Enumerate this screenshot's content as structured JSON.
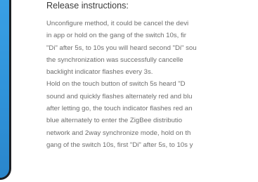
{
  "section": {
    "title": "Release instructions:",
    "lines": [
      "Unconfigure method, it could be cancel the devi",
      "in app or hold on the gang of the switch 10s, fir",
      "\"Di\" after 5s, to 10s you will heard second \"Di\" sou",
      "the synchronization was successfully cancelle",
      "backlight indicator flashes every 3s.",
      "Hold on the touch button of switch 5s heard \"D",
      "sound and quickly flashes alternately red and blu",
      "after letting go, the touch indicator flashes red an",
      "blue alternately to enter the ZigBee distributio",
      "network and 2way synchronize mode, hold on th",
      "gang of the switch 10s, first \"Di\" after 5s, to 10s y"
    ]
  },
  "illustration": {
    "name": "phone-illustration",
    "colors": {
      "screen": "#3aa1e6",
      "frame": "#1b1f24",
      "indicator": "#ffffff"
    }
  }
}
